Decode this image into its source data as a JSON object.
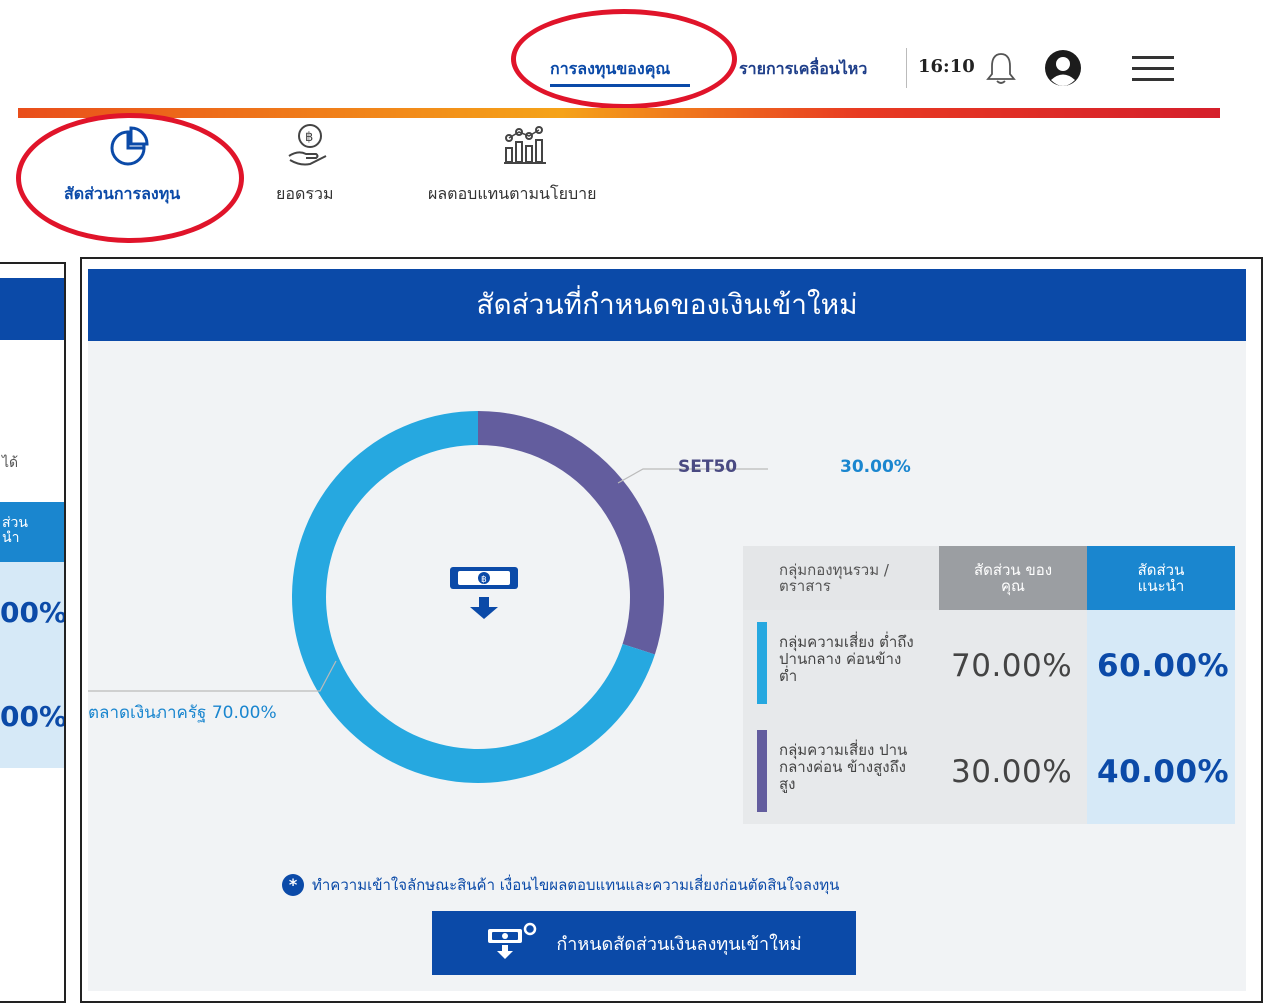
{
  "topnav": {
    "tabs": [
      {
        "label": "การลงทุนของคุณ",
        "active": true
      },
      {
        "label": "รายการเคลื่อนไหว",
        "active": false
      }
    ],
    "time": "16:10"
  },
  "subnav": {
    "items": [
      {
        "label": "สัดส่วนการลงทุน",
        "icon": "pie-chart-icon",
        "active": true
      },
      {
        "label": "ยอดรวม",
        "icon": "coin-hand-icon",
        "active": false
      },
      {
        "label": "ผลตอบแทนตามนโยบาย",
        "icon": "bar-chart-icon",
        "active": false
      }
    ]
  },
  "left_panel": {
    "text_fragment": "ได้",
    "header_fragment_1": "ส่วน",
    "header_fragment_2": "นำ",
    "value_1": "00%",
    "value_2": "00%"
  },
  "main_panel": {
    "title": "สัดส่วนที่กำหนดของเงินเข้าใหม่",
    "donut": {
      "segments": [
        {
          "label": "SET50",
          "value_text": "30.00%",
          "value": 30,
          "color": "#635d9e"
        },
        {
          "label": "ตลาดเงินภาครัฐ 70.00%",
          "value": 70,
          "color": "#26a8e0"
        }
      ]
    },
    "table": {
      "col_group": "กลุ่มกองทุนรวม / ตราสาร",
      "col_yours": "สัดส่วน ของคุณ",
      "col_recommended": "สัดส่วน แนะนำ",
      "rows": [
        {
          "group": "กลุ่มความเสี่ยง ต่ำถึงปานกลาง ค่อนข้างต่ำ",
          "yours": "70.00%",
          "recommended": "60.00%",
          "color": "#26a8e0"
        },
        {
          "group": "กลุ่มความเสี่ยง ปานกลางค่อน ข้างสูงถึงสูง",
          "yours": "30.00%",
          "recommended": "40.00%",
          "color": "#635d9e"
        }
      ]
    },
    "notice": "ทำความเข้าใจลักษณะสินค้า เงื่อนไขผลตอบแทนและความเสี่ยงก่อนตัดสินใจลงทุน",
    "cta_label": "กำหนดสัดส่วนเงินลงทุนเข้าใหม่"
  }
}
